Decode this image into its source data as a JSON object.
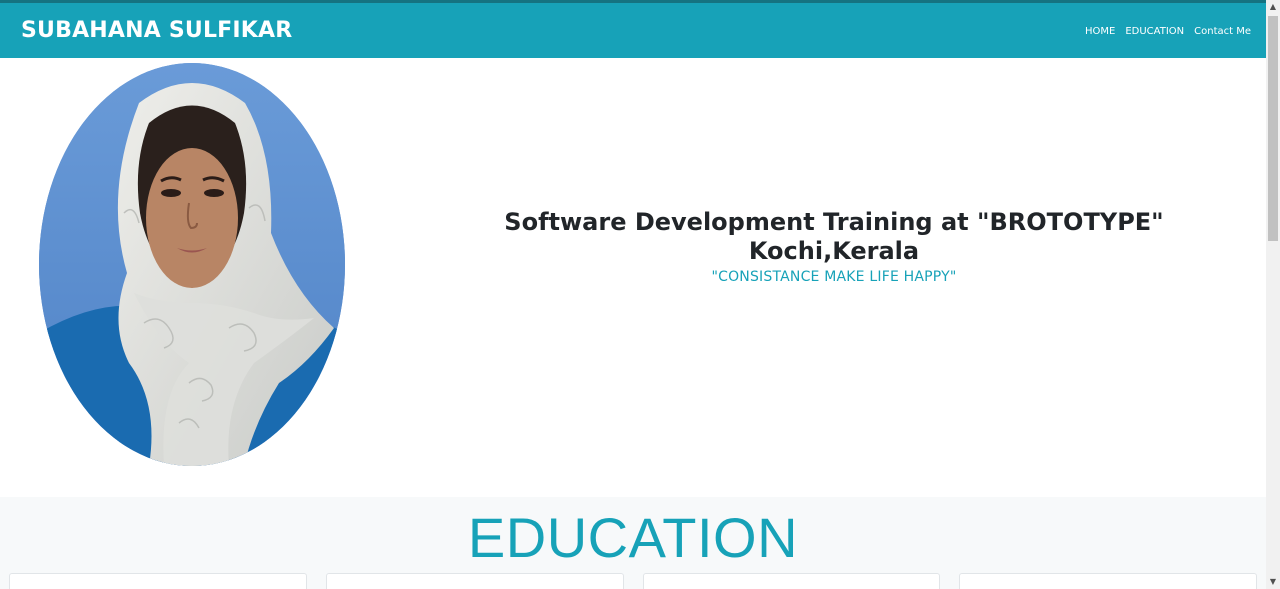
{
  "navbar": {
    "brand": "SUBAHANA SULFIKAR",
    "links": [
      {
        "label": "HOME"
      },
      {
        "label": "EDUCATION"
      },
      {
        "label": "Contact Me"
      }
    ]
  },
  "hero": {
    "headline_line1": "Software Development Training at \"BROTOTYPE\"",
    "headline_line2": "Kochi,Kerala",
    "quote": "\"CONSISTANCE MAKE LIFE HAPPY\""
  },
  "education": {
    "title": "EDUCATION"
  },
  "colors": {
    "accent": "#17a2b8",
    "section_bg": "#f7f9fa"
  }
}
